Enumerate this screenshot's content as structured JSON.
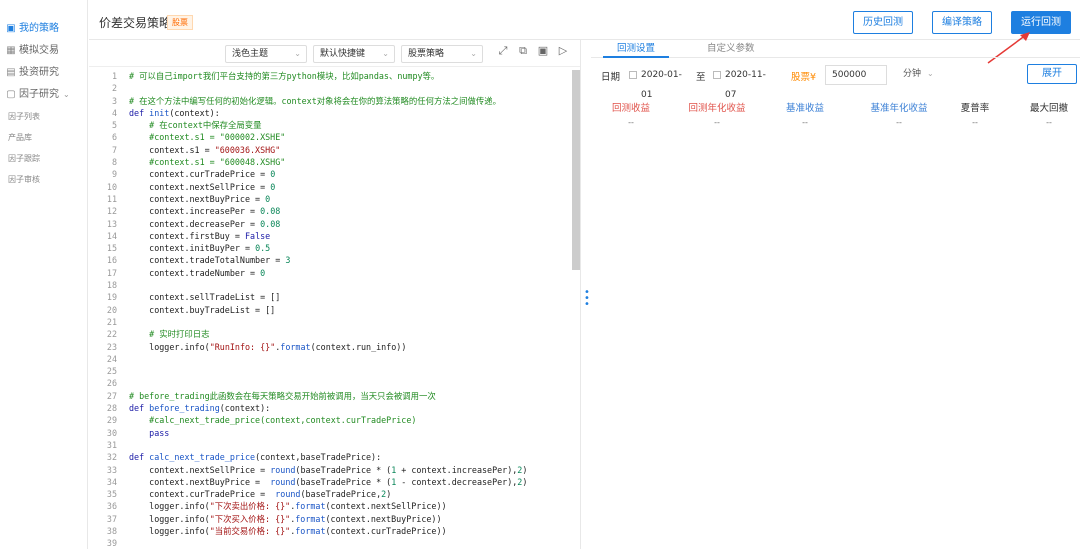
{
  "sidebar": {
    "items": [
      {
        "label": "我的策略",
        "icon": "document-icon",
        "active": true
      },
      {
        "label": "模拟交易",
        "icon": "grid-icon",
        "active": false
      },
      {
        "label": "投资研究",
        "icon": "chart-icon",
        "active": false
      },
      {
        "label": "因子研究",
        "icon": "box-icon",
        "active": false
      }
    ],
    "subitems": [
      "因子列表",
      "产品库",
      "因子跟踪",
      "因子审核"
    ]
  },
  "header": {
    "title": "价差交易策略",
    "tag": "股票",
    "buttons": {
      "history": "历史回测",
      "compile": "编译策略",
      "run": "运行回测"
    }
  },
  "editor": {
    "toolbar": {
      "theme": "浅色主题",
      "shortcut": "默认快捷键",
      "strategy_type": "股票策略"
    },
    "lines": [
      [
        [
          "c-com",
          "# 可以自己import我们平台支持的第三方python模块，比如pandas、numpy等。"
        ]
      ],
      [],
      [
        [
          "c-com",
          "# 在这个方法中编写任何的初始化逻辑。context对象将会在你的算法策略的任何方法之间做传递。"
        ]
      ],
      [
        [
          "c-kw",
          "def "
        ],
        [
          "c-fn",
          "init"
        ],
        [
          "tx",
          "(context):"
        ]
      ],
      [
        [
          "tx",
          "    "
        ],
        [
          "c-com",
          "# 在context中保存全局变量"
        ]
      ],
      [
        [
          "tx",
          "    "
        ],
        [
          "c-com",
          "#context.s1 = \"000002.XSHE\""
        ]
      ],
      [
        [
          "tx",
          "    context.s1 = "
        ],
        [
          "c-str",
          "\"600036.XSHG\""
        ]
      ],
      [
        [
          "tx",
          "    "
        ],
        [
          "c-com",
          "#context.s1 = \"600048.XSHG\""
        ]
      ],
      [
        [
          "tx",
          "    context.curTradePrice = "
        ],
        [
          "c-num",
          "0"
        ]
      ],
      [
        [
          "tx",
          "    context.nextSellPrice = "
        ],
        [
          "c-num",
          "0"
        ]
      ],
      [
        [
          "tx",
          "    context.nextBuyPrice = "
        ],
        [
          "c-num",
          "0"
        ]
      ],
      [
        [
          "tx",
          "    context.increasePer = "
        ],
        [
          "c-num",
          "0.08"
        ]
      ],
      [
        [
          "tx",
          "    context.decreasePer = "
        ],
        [
          "c-num",
          "0.08"
        ]
      ],
      [
        [
          "tx",
          "    context.firstBuy = "
        ],
        [
          "c-kw",
          "False"
        ]
      ],
      [
        [
          "tx",
          "    context.initBuyPer = "
        ],
        [
          "c-num",
          "0.5"
        ]
      ],
      [
        [
          "tx",
          "    context.tradeTotalNumber = "
        ],
        [
          "c-num",
          "3"
        ]
      ],
      [
        [
          "tx",
          "    context.tradeNumber = "
        ],
        [
          "c-num",
          "0"
        ]
      ],
      [],
      [
        [
          "tx",
          "    context.sellTradeList = []"
        ]
      ],
      [
        [
          "tx",
          "    context.buyTradeList = []"
        ]
      ],
      [],
      [
        [
          "tx",
          "    "
        ],
        [
          "c-com",
          "# 实时打印日志"
        ]
      ],
      [
        [
          "tx",
          "    logger.info("
        ],
        [
          "c-str",
          "\"RunInfo: {}\""
        ],
        [
          "tx",
          "."
        ],
        [
          "c-fn",
          "format"
        ],
        [
          "tx",
          "(context.run_info))"
        ]
      ],
      [],
      [],
      [],
      [
        [
          "c-com",
          "# before_trading此函数会在每天策略交易开始前被调用，当天只会被调用一次"
        ]
      ],
      [
        [
          "c-kw",
          "def "
        ],
        [
          "c-fn",
          "before_trading"
        ],
        [
          "tx",
          "(context):"
        ]
      ],
      [
        [
          "tx",
          "    "
        ],
        [
          "c-com",
          "#calc_next_trade_price(context,context.curTradePrice)"
        ]
      ],
      [
        [
          "tx",
          "    "
        ],
        [
          "c-kw",
          "pass"
        ]
      ],
      [],
      [
        [
          "c-kw",
          "def "
        ],
        [
          "c-fn",
          "calc_next_trade_price"
        ],
        [
          "tx",
          "(context,baseTradePrice):"
        ]
      ],
      [
        [
          "tx",
          "    context.nextSellPrice = "
        ],
        [
          "c-fn",
          "round"
        ],
        [
          "tx",
          "(baseTradePrice * ("
        ],
        [
          "c-num",
          "1"
        ],
        [
          "tx",
          " + context.increasePer),"
        ],
        [
          "c-num",
          "2"
        ],
        [
          "tx",
          ")"
        ]
      ],
      [
        [
          "tx",
          "    context.nextBuyPrice =  "
        ],
        [
          "c-fn",
          "round"
        ],
        [
          "tx",
          "(baseTradePrice * ("
        ],
        [
          "c-num",
          "1"
        ],
        [
          "tx",
          " - context.decreasePer),"
        ],
        [
          "c-num",
          "2"
        ],
        [
          "tx",
          ")"
        ]
      ],
      [
        [
          "tx",
          "    context.curTradePrice =  "
        ],
        [
          "c-fn",
          "round"
        ],
        [
          "tx",
          "(baseTradePrice,"
        ],
        [
          "c-num",
          "2"
        ],
        [
          "tx",
          ")"
        ]
      ],
      [
        [
          "tx",
          "    logger.info("
        ],
        [
          "c-str",
          "\"下次卖出价格: {}\""
        ],
        [
          "tx",
          "."
        ],
        [
          "c-fn",
          "format"
        ],
        [
          "tx",
          "(context.nextSellPrice))"
        ]
      ],
      [
        [
          "tx",
          "    logger.info("
        ],
        [
          "c-str",
          "\"下次买入价格: {}\""
        ],
        [
          "tx",
          "."
        ],
        [
          "c-fn",
          "format"
        ],
        [
          "tx",
          "(context.nextBuyPrice))"
        ]
      ],
      [
        [
          "tx",
          "    logger.info("
        ],
        [
          "c-str",
          "\"当前交易价格: {}\""
        ],
        [
          "tx",
          "."
        ],
        [
          "c-fn",
          "format"
        ],
        [
          "tx",
          "(context.curTradePrice))"
        ]
      ],
      []
    ]
  },
  "right": {
    "tabs": [
      "回测设置",
      "自定义参数"
    ],
    "params": {
      "date_label": "日期",
      "start_date": "2020-01-01",
      "to": "至",
      "end_date": "2020-11-07",
      "stock_label": "股票¥",
      "amount": "500000",
      "frequency": "分钟",
      "expand": "展开"
    },
    "stats": [
      {
        "label": "回测收益",
        "value": "--"
      },
      {
        "label": "回测年化收益",
        "value": "--"
      },
      {
        "label": "基准收益",
        "value": "--"
      },
      {
        "label": "基准年化收益",
        "value": "--"
      },
      {
        "label": "夏普率",
        "value": "--"
      },
      {
        "label": "最大回撤",
        "value": "--"
      }
    ]
  },
  "colors": {
    "accent": "#1e7fe0",
    "arrow": "#e53935",
    "return_red": "#e0524a",
    "benchmark_blue": "#3a7fd5"
  }
}
